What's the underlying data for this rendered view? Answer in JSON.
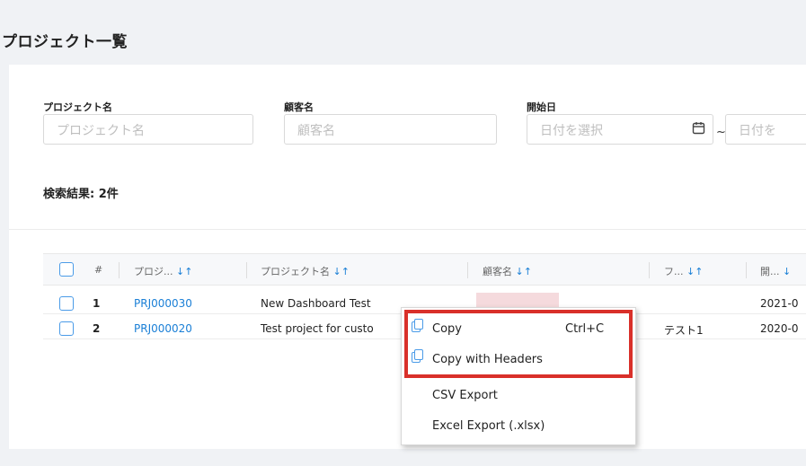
{
  "page": {
    "title": "プロジェクト一覧"
  },
  "filters": {
    "project_name": {
      "label": "プロジェクト名",
      "placeholder": "プロジェクト名"
    },
    "customer_name": {
      "label": "顧客名",
      "placeholder": "顧客名"
    },
    "start_date": {
      "label": "開始日",
      "placeholder": "日付を選択",
      "end_placeholder": "日付を",
      "separator": "~",
      "icon": "calendar-icon"
    }
  },
  "results_label": "検索結果: 2件",
  "table": {
    "columns": [
      {
        "label": "#"
      },
      {
        "label": "プロジ...",
        "sort": "↓↑"
      },
      {
        "label": "プロジェクト名",
        "sort": "↓↑"
      },
      {
        "label": "顧客名",
        "sort": "↓↑"
      },
      {
        "label": "フ...",
        "sort": "↓↑"
      },
      {
        "label": "開...",
        "sort": "↓"
      }
    ],
    "rows": [
      {
        "num": "1",
        "code": "PRJ000030",
        "name": "New Dashboard Test",
        "customer": "",
        "f": "",
        "start": "2021-0"
      },
      {
        "num": "2",
        "code": "PRJ000020",
        "name": "Test project for custo",
        "customer": "",
        "f": "テスト1",
        "start": "2020-0"
      }
    ]
  },
  "context_menu": {
    "items": [
      {
        "label": "Copy",
        "shortcut": "Ctrl+C",
        "icon": "copy-icon"
      },
      {
        "label": "Copy with Headers",
        "shortcut": "",
        "icon": "copy-icon"
      },
      {
        "label": "CSV Export",
        "shortcut": ""
      },
      {
        "label": "Excel Export (.xlsx)",
        "shortcut": ""
      }
    ],
    "highlight_color": "#d9302a"
  },
  "colors": {
    "accent": "#1a7fd6",
    "checkbox": "#4a9be8"
  }
}
